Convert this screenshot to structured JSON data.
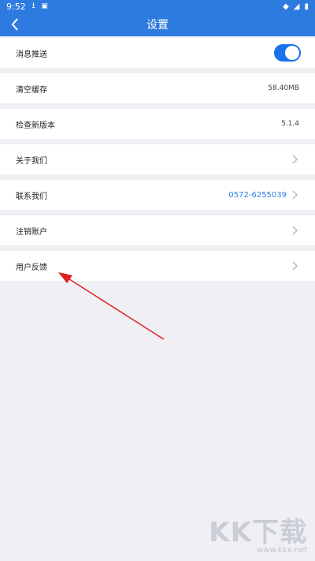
{
  "status_bar": {
    "time": "9:52"
  },
  "header": {
    "title": "设置"
  },
  "rows": [
    {
      "label": "消息推送",
      "type": "toggle",
      "on": true
    },
    {
      "label": "清空缓存",
      "value": "58.40MB"
    },
    {
      "label": "检查新版本",
      "value": "5.1.4"
    },
    {
      "label": "关于我们"
    },
    {
      "label": "联系我们",
      "value": "0572-6255039"
    },
    {
      "label": "注销账户"
    },
    {
      "label": "用户反馈"
    }
  ],
  "watermark": {
    "brand": "KK下载",
    "url": "www.kkx.net"
  },
  "colors": {
    "primary": "#2e7be0",
    "toggle_on": "#1a73e8",
    "annotation_arrow": "#e02020"
  }
}
